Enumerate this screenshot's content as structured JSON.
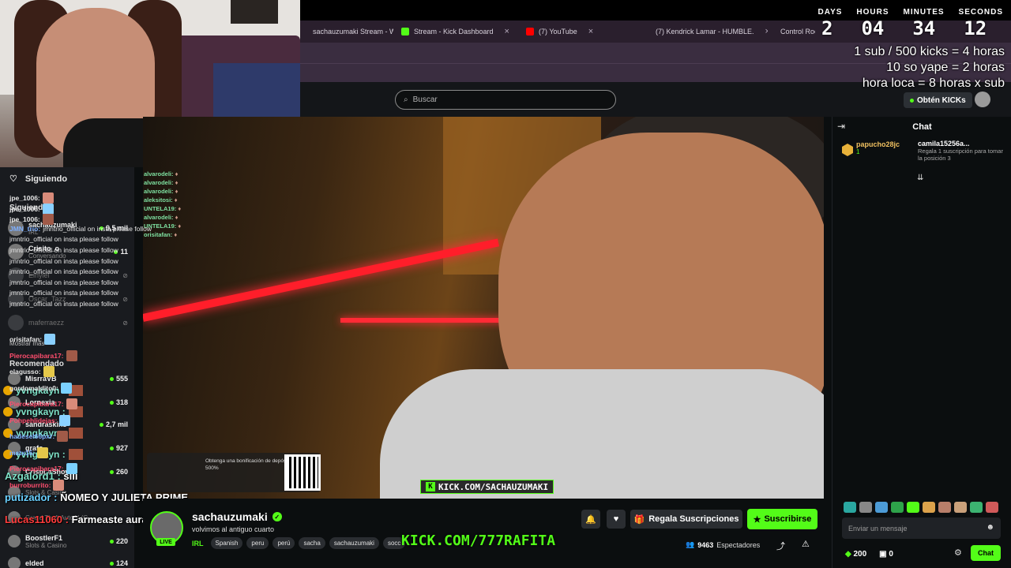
{
  "browser": {
    "tabs": [
      {
        "label": "sachauzumaki Stream - Wa",
        "close": "×",
        "color": "#53fc18"
      },
      {
        "label": "Stream - Kick Dashboard",
        "close": "×",
        "color": "#53fc18"
      },
      {
        "label": "(7) YouTube",
        "close": "×",
        "color": "#ff0000"
      },
      {
        "label": "(7) Kendrick Lamar - HUMBLE.",
        "close": "×",
        "color": "#ff0000"
      },
      {
        "label": "Control Roo",
        "close": "",
        "color": "#cccccc"
      }
    ]
  },
  "countdown": {
    "labels": [
      "DAYS",
      "HOURS",
      "MINUTES",
      "SECONDS"
    ],
    "values": [
      "2",
      "04",
      "34",
      "12"
    ]
  },
  "overlay_rules": [
    "1 sub / 500 kicks = 4 horas",
    "10 so yape = 2 horas",
    "hora loca = 8 horas x sub"
  ],
  "header": {
    "search_placeholder": "Buscar",
    "get_kicks": "Obtén KICKs"
  },
  "sidebar": {
    "following_title": "Siguiendo",
    "following_section": "Siguiendo",
    "following": [
      {
        "name": "sachauzumaki",
        "sub": "IRL",
        "count": "9,5 mil",
        "online": true
      },
      {
        "name": "Crisito_o",
        "sub": "Conversando",
        "count": "11",
        "online": true
      },
      {
        "name": "Einyiel",
        "sub": "",
        "count": "",
        "online": false
      },
      {
        "name": "Oscar_Tazz",
        "sub": "",
        "count": "",
        "online": false
      },
      {
        "name": "maferraezz",
        "sub": "",
        "count": "",
        "online": false
      }
    ],
    "show_more": "Mostrar más",
    "recommended_section": "Recomendado",
    "recommended": [
      {
        "name": "MisrraVB",
        "sub": "",
        "count": "555"
      },
      {
        "name": "Lornexia",
        "sub": "",
        "count": "318"
      },
      {
        "name": "sandraskins",
        "sub": "",
        "count": "2,7 mil"
      },
      {
        "name": "grafo",
        "sub": "",
        "count": "927"
      },
      {
        "name": "CrispLaShow",
        "sub": "",
        "count": "260"
      },
      {
        "name": "",
        "sub": "Slots & Casino",
        "count": ""
      },
      {
        "name": "",
        "sub": "Grand Theft Auto V (G...",
        "count": ""
      },
      {
        "name": "BoostlerF1",
        "sub": "Slots & Casino",
        "count": "220"
      },
      {
        "name": "elded",
        "sub": "",
        "count": "124"
      }
    ]
  },
  "video_chat_overlay": [
    "alvarodeli:",
    "alvarodeli:",
    "alvarodeli:",
    "aleksitosi:",
    "UNTELA19:",
    "alvarodeli:",
    "UNTELA19:",
    "orisitafan:"
  ],
  "video_ad": {
    "text": "Obtenga una bonificación de depósito del 500%"
  },
  "video_kick_url": "KICK.COM/SACHAUZUMAKI",
  "left_overlay": {
    "yvng": [
      "yvngkayn :",
      "yvngkayn :",
      "yvngkayn :",
      "yvngkayn :"
    ],
    "lines": [
      {
        "user": "Azgalord1 :",
        "msg": "siii"
      },
      {
        "user": "putizador :",
        "msg": "ÑOMEO Y JULIETA PRIME"
      },
      {
        "user": "Lucas11060 :",
        "msg": "Farmeaste aura"
      }
    ]
  },
  "stream": {
    "streamer": "sachauzumaki",
    "live": "LIVE",
    "title": "volvimos al antiguo cuarto",
    "category": "IRL",
    "tags": [
      "Spanish",
      "peru",
      "perú",
      "sacha",
      "sachauzumaki",
      "socc"
    ],
    "kick_url": "KICK.COM/777RAFITA",
    "gift_button": "Regala Suscripciones",
    "subscribe_button": "Suscribirse",
    "viewers_count": "9463",
    "viewers_label": "Espectadores"
  },
  "chat": {
    "title": "Chat",
    "pinned_left": {
      "name": "papucho28jc",
      "count": "1"
    },
    "pinned_right": {
      "name": "camila15256a...",
      "text": "Regala 1 suscripción para tomar la posición 3"
    },
    "messages": [
      {
        "user": "jpe_1006:",
        "msg": "",
        "color": "#e6e6e6"
      },
      {
        "user": "jpe_1006:",
        "msg": "",
        "color": "#e6e6e6"
      },
      {
        "user": "jpe_1006:",
        "msg": "",
        "color": "#e6e6e6"
      },
      {
        "user": "JMN_trio:",
        "msg": "jmntrio_official on insta please follow",
        "color": "#7fb0ff"
      },
      {
        "user": "",
        "msg": "jmntrio_official on insta please follow",
        "color": "#e6e6e6"
      },
      {
        "user": "",
        "msg": "jmntrio_official on insta please follow",
        "color": "#e6e6e6"
      },
      {
        "user": "",
        "msg": "jmntrio_official on insta please follow",
        "color": "#e6e6e6"
      },
      {
        "user": "",
        "msg": "jmntrio_official on insta please follow",
        "color": "#e6e6e6"
      },
      {
        "user": "",
        "msg": "jmntrio_official on insta please follow",
        "color": "#e6e6e6"
      },
      {
        "user": "",
        "msg": "jmntrio_official on insta please follow",
        "color": "#e6e6e6"
      },
      {
        "user": "",
        "msg": "jmntrio_official on insta please follow",
        "color": "#e6e6e6"
      },
      {
        "user": "orisitafan:",
        "msg": "",
        "color": "#e6e6e6"
      },
      {
        "user": "Pierocapibara17:",
        "msg": "",
        "color": "#ff4d6d"
      },
      {
        "user": "elagusso:",
        "msg": "",
        "color": "#e6e6e6"
      },
      {
        "user": "gordomaldito0:",
        "msg": "",
        "color": "#e6e6e6"
      },
      {
        "user": "Pierocapibara17:",
        "msg": "",
        "color": "#ff4d6d"
      },
      {
        "user": "Pohpehlidejas:",
        "msg": "",
        "color": "#ff4d6d"
      },
      {
        "user": "hadesel66pxr:",
        "msg": "",
        "color": "#7fb0ff"
      },
      {
        "user": "matx15:",
        "msg": "",
        "color": "#7fb0ff"
      },
      {
        "user": "Pierocapibara17:",
        "msg": "",
        "color": "#ff4d6d"
      },
      {
        "user": "burroburrito:",
        "msg": "",
        "color": "#ff4d6d"
      }
    ],
    "input_placeholder": "Enviar un mensaje",
    "kicks_balance": "200",
    "points": "0",
    "chat_button": "Chat"
  },
  "colors": {
    "kick_green": "#53fc18",
    "bg": "#0b0e0f"
  }
}
